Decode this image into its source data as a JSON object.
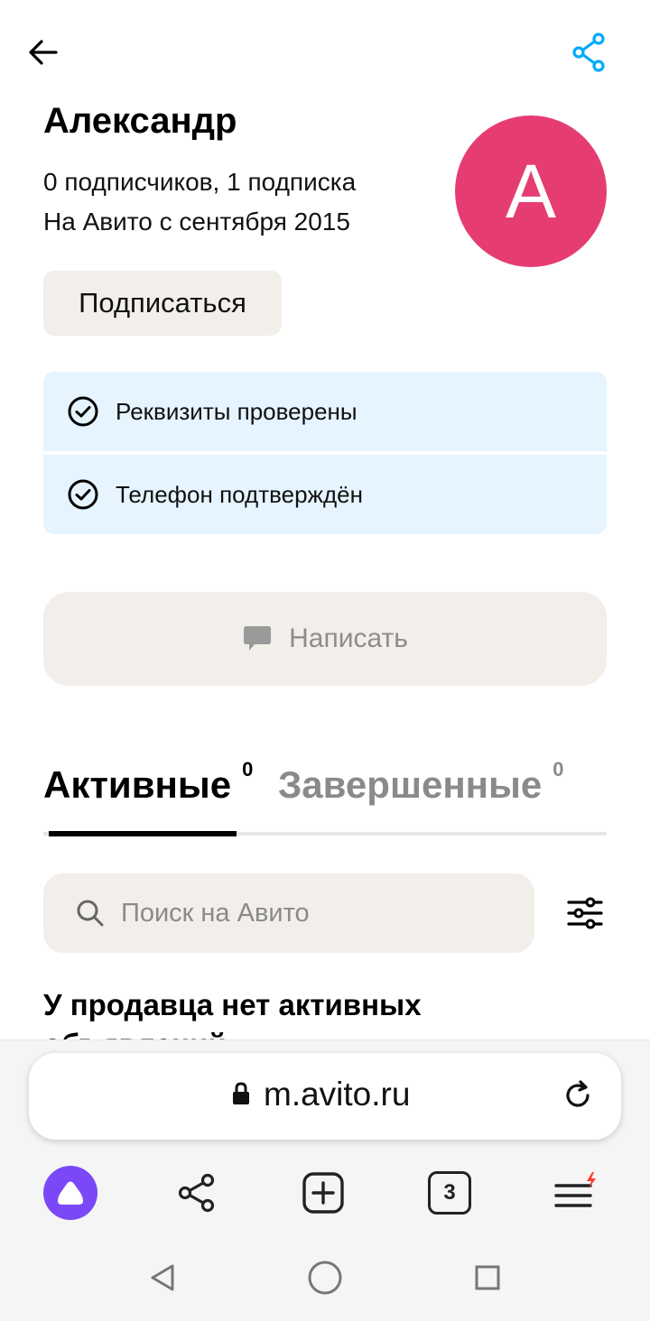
{
  "profile": {
    "name": "Александр",
    "stats": "0 подписчиков, 1 подписка",
    "since": "На Авито с сентября 2015",
    "avatar_letter": "A",
    "avatar_color": "#e53d72"
  },
  "actions": {
    "subscribe_label": "Подписаться",
    "write_label": "Написать"
  },
  "verifications": [
    {
      "label": "Реквизиты проверены"
    },
    {
      "label": "Телефон подтверждён"
    }
  ],
  "tabs": [
    {
      "label": "Активные",
      "count": "0"
    },
    {
      "label": "Завершенные",
      "count": "0"
    }
  ],
  "search": {
    "placeholder": "Поиск на Авито"
  },
  "empty_state": {
    "title": "У продавца нет активных объявлений"
  },
  "browser": {
    "url": "m.avito.ru",
    "tabs_count": "3"
  },
  "colors": {
    "accent_blue": "#00aaff",
    "verify_bg": "#e5f4fe",
    "neutral_bg": "#f2efea",
    "alice_purple": "#7b48f7",
    "badge_red": "#ff3b30"
  },
  "icons": [
    "back-arrow-icon",
    "share-icon",
    "check-circle-icon",
    "chat-bubble-icon",
    "search-icon",
    "filter-icon",
    "lock-icon",
    "reload-icon",
    "alice-icon",
    "plus-square-icon",
    "tabs-counter-icon",
    "menu-icon",
    "nav-back-icon",
    "nav-home-icon",
    "nav-recent-icon"
  ]
}
